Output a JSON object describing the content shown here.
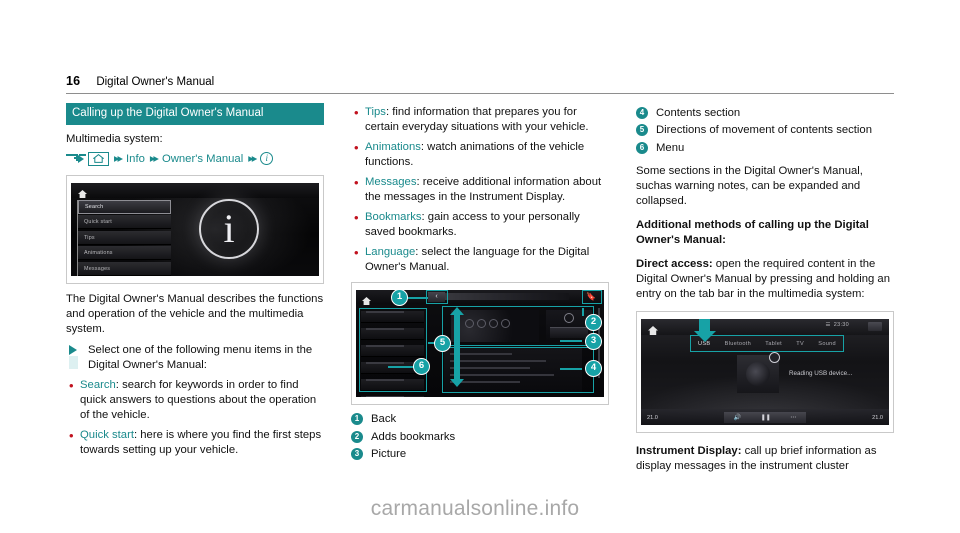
{
  "header": {
    "page_number": "16",
    "chapter_title": "Digital Owner's Manual"
  },
  "left_column": {
    "section_title": "Calling up the Digital Owner's Manual",
    "lead_line": "Multimedia system:",
    "nav_path": {
      "home_icon": "home-icon",
      "step1_label": "Info",
      "step2_label": "Owner's Manual",
      "end_icon": "info-circle-icon",
      "separator": "▸▸"
    },
    "figure1": {
      "home_icon": "home-icon",
      "menu_items": [
        "Search",
        "Quick start",
        "Tips",
        "Animations",
        "Messages"
      ],
      "center_glyph": "i"
    },
    "intro_paragraph": "The Digital Owner's Manual describes the functions and operation of the vehicle and the multimedia system.",
    "step_text": "Select one of the following menu items in the Digital Owner's Manual:",
    "bullets": [
      {
        "keyword": "Search",
        "text": ": search for keywords in order to find quick answers to questions about the operation of the vehicle."
      },
      {
        "keyword": "Quick start",
        "text": ": here is where you find the first steps towards setting up your vehicle."
      }
    ]
  },
  "middle_column": {
    "bullets": [
      {
        "keyword": "Tips",
        "text": ": find information that prepares you for certain everyday situations with your vehicle."
      },
      {
        "keyword": "Animations",
        "text": ": watch animations of the vehicle functions."
      },
      {
        "keyword": "Messages",
        "text": ": receive additional information about the messages in the Instrument Display."
      },
      {
        "keyword": "Bookmarks",
        "text": ": gain access to your personally saved bookmarks."
      },
      {
        "keyword": "Language",
        "text": ": select the language for the Digital Owner's Manual."
      }
    ],
    "figure2": {
      "home_icon": "home-icon",
      "back_icon": "chevron-left-icon",
      "bookmark_icon": "bookmark-icon",
      "callouts": [
        "1",
        "2",
        "3",
        "4",
        "5",
        "6"
      ]
    },
    "legend": [
      {
        "num": "1",
        "label": "Back"
      },
      {
        "num": "2",
        "label": "Adds bookmarks"
      },
      {
        "num": "3",
        "label": "Picture"
      }
    ]
  },
  "right_column": {
    "legend": [
      {
        "num": "4",
        "label": "Contents section"
      },
      {
        "num": "5",
        "label": "Directions of movement of contents section"
      },
      {
        "num": "6",
        "label": "Menu"
      }
    ],
    "paragraph1": "Some sections in the Digital Owner's Manual, suchas warning notes, can be expanded and collapsed.",
    "subhead": "Additional methods of calling up the Digital Owner's Manual:",
    "direct_access_label": "Direct access:",
    "direct_access_text": " open the required content in the Digital Owner's Manual by pressing and holding an entry on the tab bar in the multimedia system:",
    "figure3": {
      "home_icon": "home-icon",
      "tabs": [
        "USB",
        "Bluetooth",
        "Tablet",
        "TV",
        "Sound"
      ],
      "active_tab": "USB",
      "status_time": "23:30",
      "message_text": "Reading USB device...",
      "temp_left": "21.0",
      "temp_right": "21.0",
      "arrow_icon": "down-arrow-icon"
    },
    "instrument_label": "Instrument Display:",
    "instrument_text": " call up brief information as display messages in the instrument cluster"
  },
  "watermark": "carmanualsonline.info",
  "colors": {
    "teal": "#1a8a8c",
    "teal_bright": "#17a2a6",
    "bullet_red": "#c1121f"
  }
}
